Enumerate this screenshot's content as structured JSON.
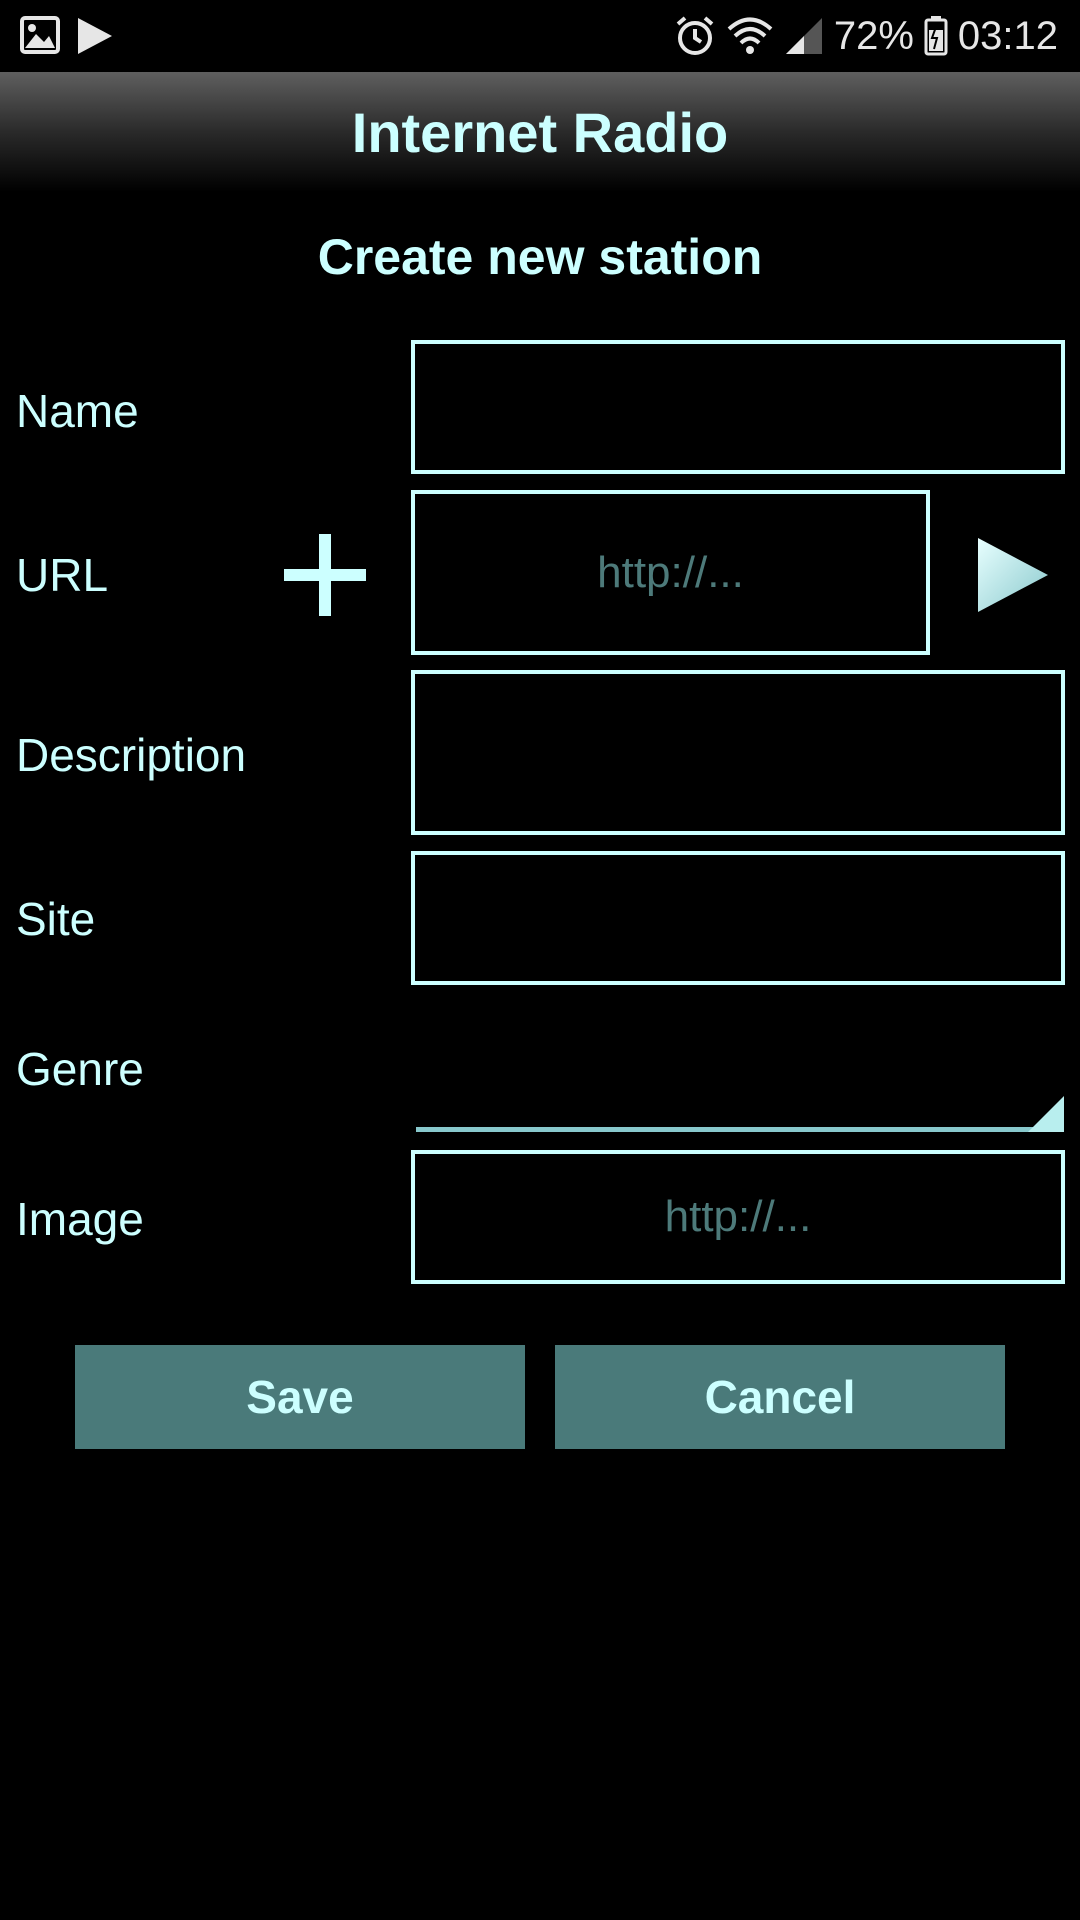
{
  "status_bar": {
    "battery_percent": "72%",
    "time": "03:12",
    "icons": [
      "gallery-icon",
      "play-store-icon",
      "alarm-icon",
      "wifi-icon",
      "signal-icon",
      "battery-icon"
    ]
  },
  "app_bar": {
    "title": "Internet Radio"
  },
  "form": {
    "title": "Create new station",
    "fields": {
      "name": {
        "label": "Name",
        "value": "",
        "placeholder": ""
      },
      "url": {
        "label": "URL",
        "value": "",
        "placeholder": "http://..."
      },
      "description": {
        "label": "Description",
        "value": "",
        "placeholder": ""
      },
      "site": {
        "label": "Site",
        "value": "",
        "placeholder": ""
      },
      "genre": {
        "label": "Genre",
        "selected": ""
      },
      "image": {
        "label": "Image",
        "value": "",
        "placeholder": "http://..."
      }
    }
  },
  "buttons": {
    "save": "Save",
    "cancel": "Cancel"
  },
  "colors": {
    "background": "#000000",
    "accent_text": "#ccffff",
    "placeholder_text": "#4d7a7a",
    "button_bg": "#4a7a7a"
  }
}
